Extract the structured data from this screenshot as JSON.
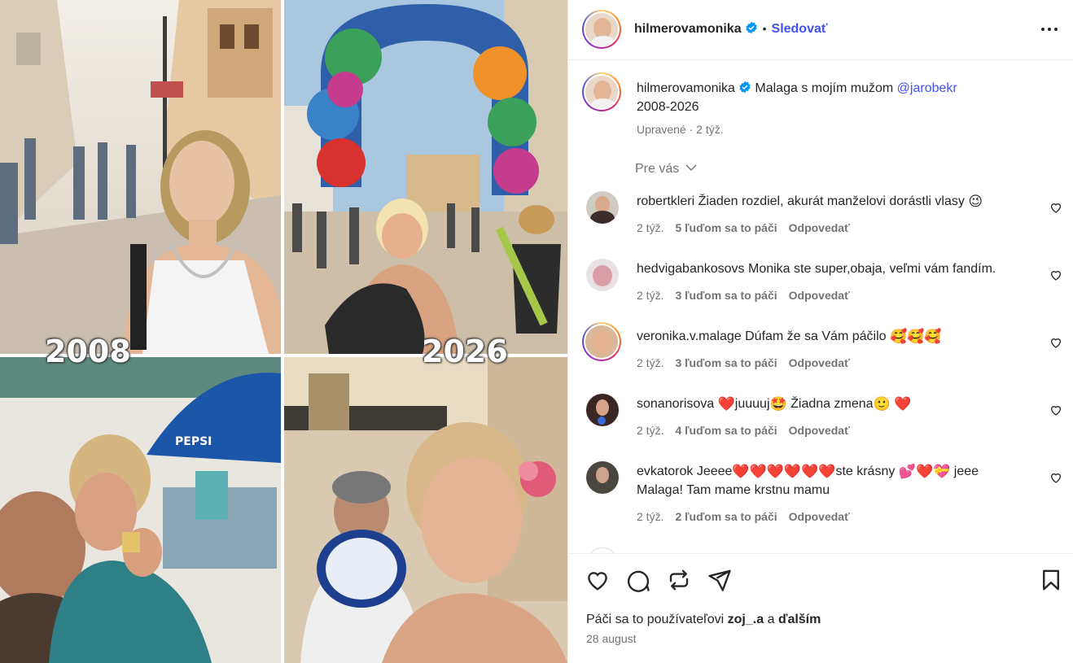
{
  "post": {
    "username": "hilmerovamonika",
    "follow_label": "Sledovať",
    "separator": "•",
    "year_left": "2008",
    "year_right": "2026"
  },
  "caption": {
    "username": "hilmerovamonika",
    "text": "Malaga s mojím mužom",
    "mention": "@jarobekr",
    "line2": "2008-2026",
    "edited": "Upravené · 2 týž."
  },
  "section_label": "Pre vás",
  "comments": [
    {
      "username": "robertkleri",
      "text": "Žiaden rozdiel, akurát manželovi dorástli vlasy",
      "emoji": "😉",
      "time": "2 týž.",
      "likes": "5 ľuďom sa to páči",
      "reply": "Odpovedať"
    },
    {
      "username": "hedvigabankosovs",
      "text": "Monika ste super,obaja, veľmi vám fandím.",
      "time": "2 týž.",
      "likes": "3 ľuďom sa to páči",
      "reply": "Odpovedať"
    },
    {
      "username": "veronika.v.malage",
      "text": "Dúfam že sa Vám páčilo",
      "emoji": "🥰🥰🥰",
      "time": "2 týž.",
      "likes": "3 ľuďom sa to páči",
      "reply": "Odpovedať"
    },
    {
      "username": "sonanorisova",
      "text_a": "juuuuj",
      "text_b": "Žiadna zmena",
      "emoji_a": "❤️",
      "emoji_b": "🤩",
      "emoji_c": "🙂",
      "emoji_d": "❤️",
      "time": "2 týž.",
      "likes": "4 ľuďom sa to páči",
      "reply": "Odpovedať"
    },
    {
      "username": "evkatorok",
      "text_a": "Jeeee",
      "hearts_a": "❤️❤️❤️❤️❤️❤️",
      "text_b": "ste krásny",
      "hearts_b": "💕❤️💝",
      "text_c": "jeee",
      "line2": "Malaga! Tam mame krstnu mamu",
      "time": "2 týž.",
      "likes": "2 ľuďom sa to páči",
      "reply": "Odpovedať"
    }
  ],
  "footer": {
    "likes_prefix": "Páči sa to používateľovi",
    "likes_user": "zoj_.a",
    "likes_mid": "a",
    "likes_suffix": "ďalším",
    "date": "28 august"
  },
  "icons": {
    "like": "heart-icon",
    "comment": "comment-icon",
    "repost": "repost-icon",
    "share": "share-icon",
    "save": "bookmark-icon",
    "more": "more-icon",
    "verified": "verified-badge-icon",
    "chevron": "chevron-down-icon"
  },
  "colors": {
    "link": "#4150f7",
    "muted": "#737373",
    "verified": "#0095f6"
  }
}
